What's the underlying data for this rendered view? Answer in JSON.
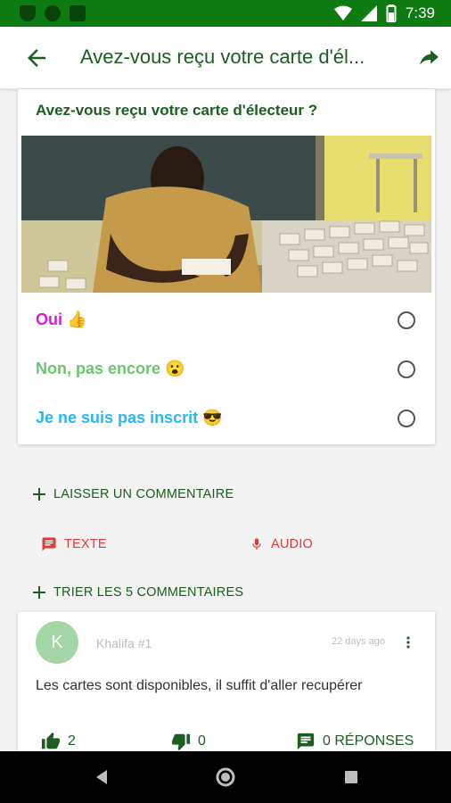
{
  "status_bar": {
    "time": "7:39"
  },
  "app_bar": {
    "title": "Avez-vous reçu votre carte d'él..."
  },
  "poll": {
    "question": "Avez-vous reçu votre carte d'électeur ?",
    "options": [
      {
        "label": "Oui 👍",
        "color": "#d81bd8"
      },
      {
        "label": "Non, pas encore 😮",
        "color": "#6cc66c"
      },
      {
        "label": "Je ne suis pas inscrit 😎",
        "color": "#29b6f6"
      }
    ]
  },
  "actions": {
    "leave_comment": "LAISSER UN COMMENTAIRE",
    "text": "TEXTE",
    "audio": "AUDIO",
    "sort_comments": "TRIER LES 5 COMMENTAIRES"
  },
  "comment": {
    "avatar_letter": "K",
    "author": "Khalifa #1",
    "time": "22 days ago",
    "text": "Les cartes sont disponibles, il suffit d'aller recupérer",
    "likes": "2",
    "dislikes": "0",
    "replies": "0 RÉPONSES"
  },
  "colors": {
    "primary": "#1b5e20",
    "status_bar": "#0e7a12",
    "accent_red": "#e53935"
  },
  "icons": [
    "back-arrow-icon",
    "share-icon",
    "plus-icon",
    "message-icon",
    "mic-icon",
    "thumb-up-icon",
    "thumb-down-icon",
    "comment-icon",
    "more-vert-icon"
  ]
}
